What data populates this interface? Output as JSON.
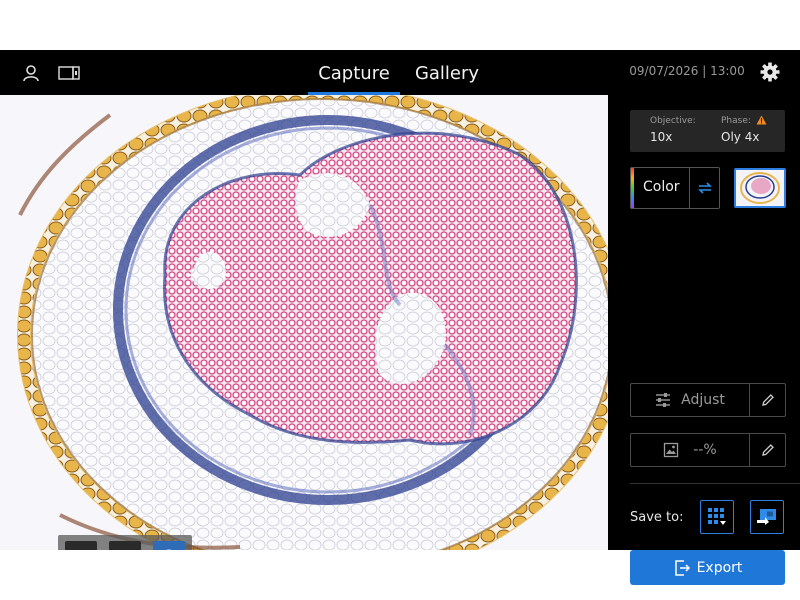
{
  "header": {
    "tabs": [
      {
        "label": "Capture",
        "active": true
      },
      {
        "label": "Gallery",
        "active": false
      }
    ],
    "datetime": "09/07/2026 | 13:00",
    "icons": {
      "user": "user-icon",
      "camera": "camera-icon",
      "settings": "gear-icon"
    }
  },
  "toolbar": {
    "tools": [
      {
        "icon": "grid-icon",
        "active": false
      },
      {
        "icon": "measure-icon",
        "active": false
      },
      {
        "icon": "palette-icon",
        "active": true
      }
    ]
  },
  "panel": {
    "objective_label": "Objective:",
    "objective_value": "10x",
    "phase_label": "Phase:",
    "phase_value": "Oly 4x",
    "phase_warning_icon": "warning-icon",
    "color_label": "Color",
    "adjust_label": "Adjust",
    "level_value": "--%",
    "save_label": "Save to:",
    "export_label": "Export"
  },
  "colors": {
    "accent": "#1f78d8",
    "tab_underline": "#1f7ae0",
    "warning": "#f08a24",
    "panel_bg": "#000000",
    "stain_pink": "#d24a86",
    "stain_blue": "#2b3d8f",
    "stain_yellow": "#e8b54a"
  }
}
